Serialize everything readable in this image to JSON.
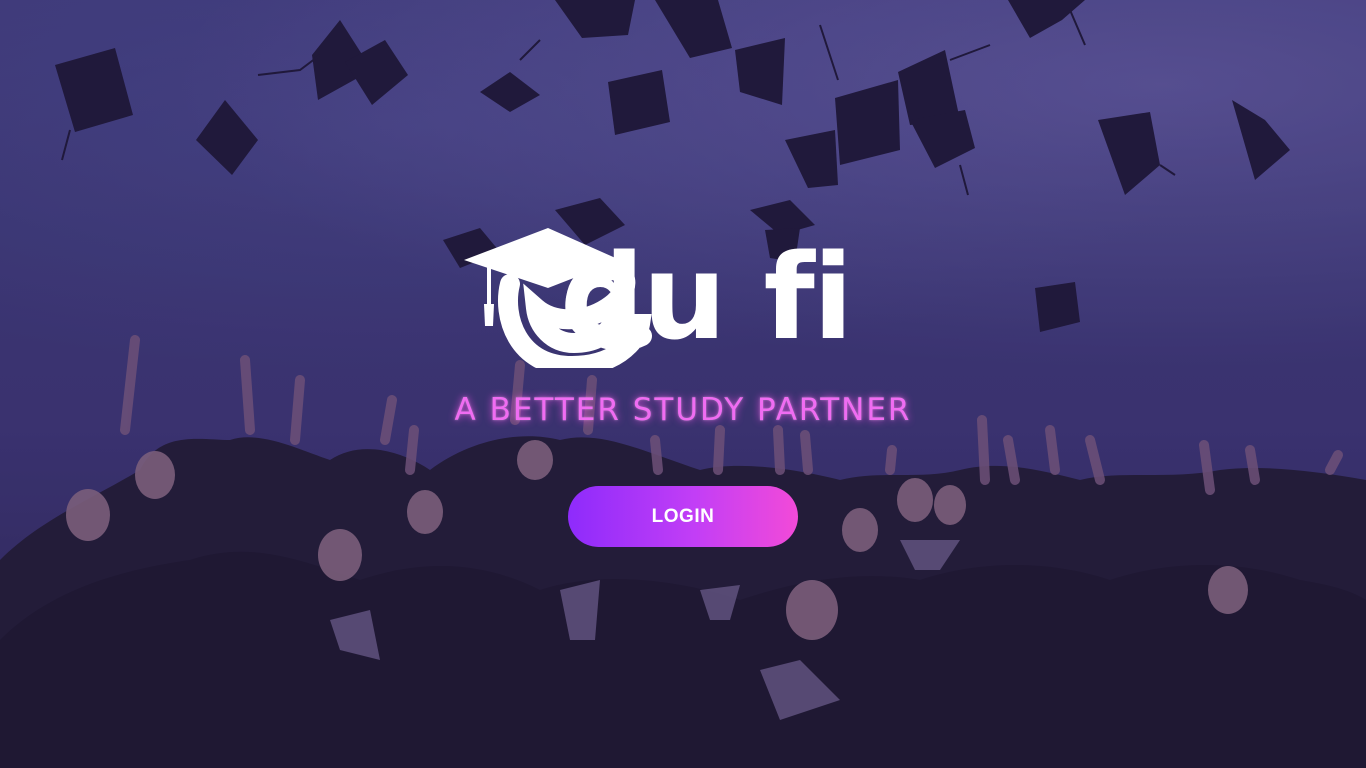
{
  "brand": {
    "logo_text": "du fi",
    "tagline": "A BETTER STUDY PARTNER"
  },
  "actions": {
    "login_label": "LOGIN"
  },
  "colors": {
    "tagline": "#f06cf2",
    "button_start": "#8e2bfb",
    "button_end": "#f24ad8",
    "background": "#3b3872"
  },
  "background": {
    "image_subject": "graduates-throwing-caps"
  }
}
